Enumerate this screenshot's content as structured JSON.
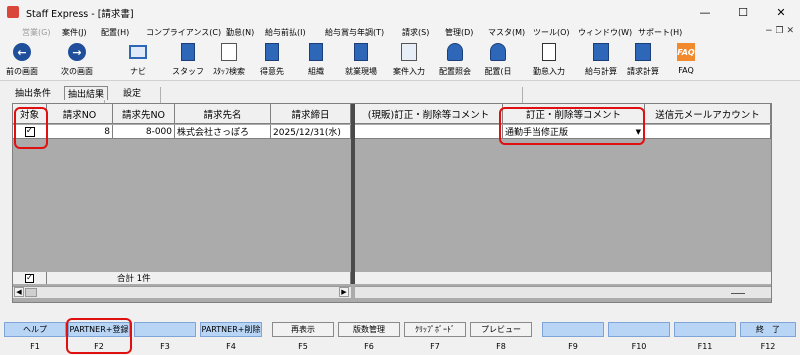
{
  "window": {
    "title": "Staff Express - [請求書]",
    "minimize": "—",
    "maximize": "☐",
    "close": "✕"
  },
  "menu": [
    "営業(G)",
    "案件(J)",
    "配置(H)",
    "コンプライアンス(C)",
    "勤怠(N)",
    "給与前払(I)",
    "給与賞与年調(T)",
    "請求(S)",
    "管理(D)",
    "マスタ(M)",
    "ツール(O)",
    "ウィンドウ(W)",
    "サポート(H)"
  ],
  "mdi_controls": "− ❐ ✕",
  "toolbar": [
    {
      "label": "前の画面",
      "icon": "back-arrow-icon"
    },
    {
      "label": "次の画面",
      "icon": "forward-arrow-icon"
    },
    {
      "label": "ナビ",
      "icon": "navi-monitor-icon"
    },
    {
      "label": "スタッフ",
      "icon": "staff-icon"
    },
    {
      "label": "ｽﾀｯﾌ検索",
      "icon": "staff-search-icon"
    },
    {
      "label": "得意先",
      "icon": "customer-icon"
    },
    {
      "label": "組織",
      "icon": "organization-icon"
    },
    {
      "label": "就業現場",
      "icon": "worksite-icon"
    },
    {
      "label": "案件入力",
      "icon": "case-input-icon"
    },
    {
      "label": "配置照会",
      "icon": "placement-inquiry-icon"
    },
    {
      "label": "配置(日",
      "icon": "placement-daily-icon"
    },
    {
      "label": "勤怠入力",
      "icon": "attendance-input-icon"
    },
    {
      "label": "給与計算",
      "icon": "payroll-calc-icon"
    },
    {
      "label": "請求計算",
      "icon": "billing-calc-icon"
    },
    {
      "label": "FAQ",
      "icon": "faq-icon"
    }
  ],
  "faq_badge": "FAQ",
  "tabs": [
    "抽出条件",
    "抽出結果",
    "設定"
  ],
  "grid": {
    "headers": [
      "対象",
      "請求NO",
      "請求先NO",
      "請求先名",
      "請求締日",
      "(現販)訂正・削除等コメント",
      "訂正・削除等コメント",
      "送信元メールアカウント"
    ],
    "row": {
      "checked": "✓",
      "no": "8",
      "customer_no": "8-000",
      "customer_name": "株式会社さっぽろ",
      "closing_date": "2025/12/31(水)",
      "comment_current": "",
      "comment": "通勤手当修正版",
      "mail_account": ""
    },
    "footer": {
      "checked": "✓",
      "total": "合計 1件"
    }
  },
  "fkeys": [
    {
      "label": "ヘルプ",
      "key": "F1"
    },
    {
      "label": "PARTNER+登録",
      "key": "F2"
    },
    {
      "label": "",
      "key": "F3"
    },
    {
      "label": "PARTNER+削除",
      "key": "F4"
    },
    {
      "label": "再表示",
      "key": "F5"
    },
    {
      "label": "版数管理",
      "key": "F6"
    },
    {
      "label": "ｸﾘｯﾌﾟﾎﾞｰﾄﾞ",
      "key": "F7"
    },
    {
      "label": "プレビュー",
      "key": "F8"
    },
    {
      "label": "",
      "key": "F9"
    },
    {
      "label": "",
      "key": "F10"
    },
    {
      "label": "",
      "key": "F11"
    },
    {
      "label": "終　了",
      "key": "F12"
    }
  ]
}
